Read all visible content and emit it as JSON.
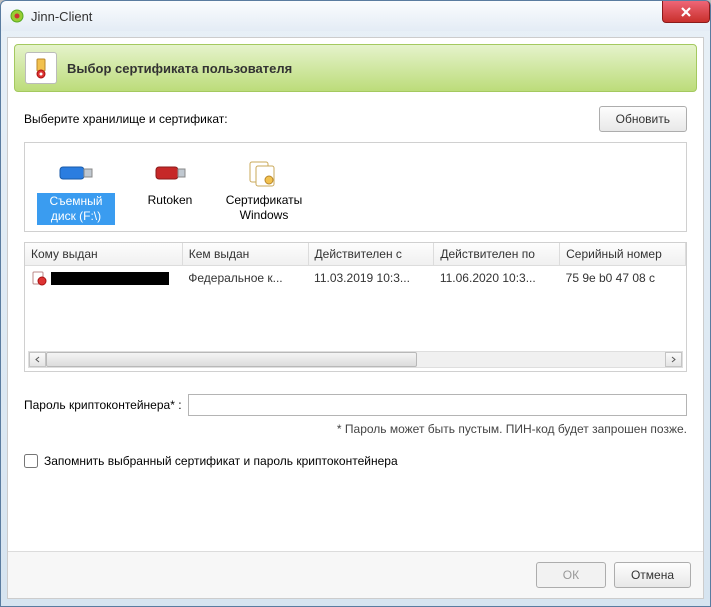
{
  "window": {
    "title": "Jinn-Client"
  },
  "banner": {
    "title": "Выбор сертификата пользователя"
  },
  "storage": {
    "label": "Выберите хранилище и сертификат:",
    "refresh_btn": "Обновить",
    "items": [
      {
        "label": "Съемный диск (F:\\)",
        "selected": true,
        "icon": "usb-blue"
      },
      {
        "label": "Rutoken",
        "selected": false,
        "icon": "usb-red"
      },
      {
        "label": "Сертификаты Windows",
        "selected": false,
        "icon": "certs"
      }
    ]
  },
  "table": {
    "columns": [
      "Кому выдан",
      "Кем выдан",
      "Действителен с",
      "Действителен по",
      "Серийный номер"
    ],
    "rows": [
      {
        "issued_to": "████████████",
        "issued_by": "Федеральное к...",
        "valid_from": "11.03.2019 10:3...",
        "valid_to": "11.06.2020 10:3...",
        "serial": "75 9e b0 47 08 c"
      }
    ]
  },
  "password": {
    "label": "Пароль криптоконтейнера* :",
    "value": "",
    "hint": "* Пароль может быть пустым. ПИН-код будет запрошен позже."
  },
  "remember": {
    "label": "Запомнить выбранный сертификат и пароль криптоконтейнера",
    "checked": false
  },
  "buttons": {
    "ok": "ОК",
    "cancel": "Отмена"
  }
}
